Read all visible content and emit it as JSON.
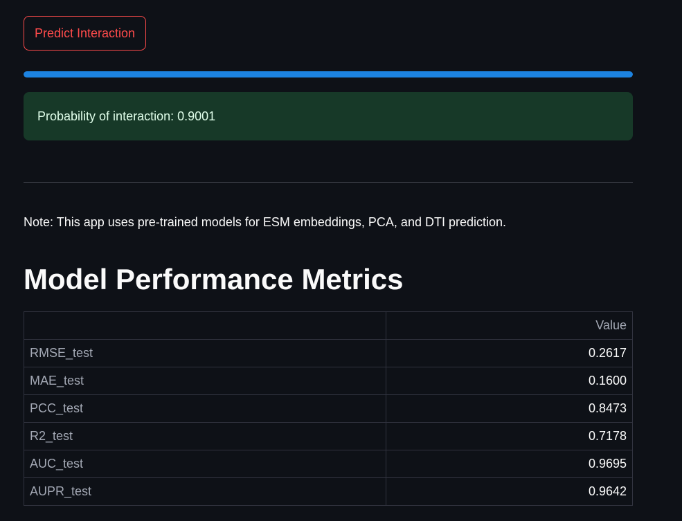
{
  "actions": {
    "predict_label": "Predict Interaction"
  },
  "progress": {
    "percent": 100
  },
  "result": {
    "message": "Probability of interaction: 0.9001"
  },
  "note": "Note: This app uses pre-trained models for ESM embeddings, PCA, and DTI prediction.",
  "metrics": {
    "title": "Model Performance Metrics",
    "columns": [
      "",
      "Value"
    ],
    "rows": [
      {
        "name": "RMSE_test",
        "value": "0.2617"
      },
      {
        "name": "MAE_test",
        "value": "0.1600"
      },
      {
        "name": "PCC_test",
        "value": "0.8473"
      },
      {
        "name": "R2_test",
        "value": "0.7178"
      },
      {
        "name": "AUC_test",
        "value": "0.9695"
      },
      {
        "name": "AUPR_test",
        "value": "0.9642"
      }
    ]
  },
  "colors": {
    "background": "#0e1117",
    "accent_red": "#ff4b4b",
    "progress_blue": "#1c83e1",
    "success_bg": "#173928"
  }
}
